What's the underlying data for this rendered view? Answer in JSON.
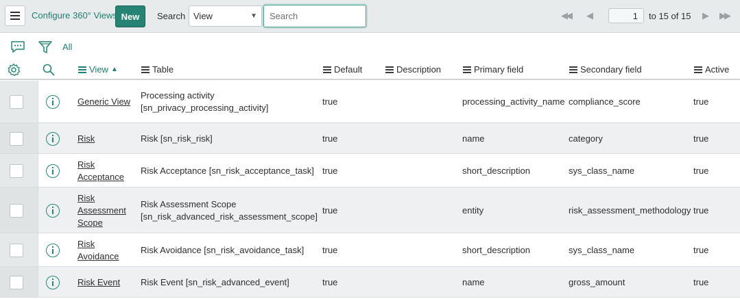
{
  "header": {
    "title": "Configure 360° Views",
    "new_label": "New",
    "search_label": "Search",
    "search_field": "View",
    "search_placeholder": "Search",
    "page_number": "1",
    "page_range": "to 15 of 15"
  },
  "filter": {
    "all_label": "All"
  },
  "columns": {
    "view": "View",
    "table": "Table",
    "default": "Default",
    "description": "Description",
    "primary_field": "Primary field",
    "secondary_field": "Secondary field",
    "active": "Active"
  },
  "rows": [
    {
      "view": [
        "Generic View"
      ],
      "table": [
        "Processing activity",
        "[sn_privacy_processing_activity]"
      ],
      "default": "true",
      "description": "",
      "primary": "processing_activity_name",
      "secondary": "compliance_score",
      "active": "true"
    },
    {
      "view": [
        "Risk"
      ],
      "table": [
        "Risk [sn_risk_risk]"
      ],
      "default": "true",
      "description": "",
      "primary": "name",
      "secondary": "category",
      "active": "true"
    },
    {
      "view": [
        "Risk",
        "Acceptance"
      ],
      "table": [
        "Risk Acceptance [sn_risk_acceptance_task]"
      ],
      "default": "true",
      "description": "",
      "primary": "short_description",
      "secondary": "sys_class_name",
      "active": "true"
    },
    {
      "view": [
        "Risk",
        "Assessment",
        "Scope"
      ],
      "table": [
        "Risk Assessment Scope",
        "[sn_risk_advanced_risk_assessment_scope]"
      ],
      "default": "true",
      "description": "",
      "primary": "entity",
      "secondary": "risk_assessment_methodology",
      "active": "true"
    },
    {
      "view": [
        "Risk",
        "Avoidance"
      ],
      "table": [
        "Risk Avoidance [sn_risk_avoidance_task]"
      ],
      "default": "true",
      "description": "",
      "primary": "short_description",
      "secondary": "sys_class_name",
      "active": "true"
    },
    {
      "view": [
        "Risk Event"
      ],
      "table": [
        "Risk Event [sn_risk_advanced_event]"
      ],
      "default": "true",
      "description": "",
      "primary": "name",
      "secondary": "gross_amount",
      "active": "true"
    }
  ],
  "colors": {
    "accent": "#278475",
    "link": "#1f7c72",
    "header_bg": "#e8ebec",
    "alt_row": "#eef0f1"
  }
}
